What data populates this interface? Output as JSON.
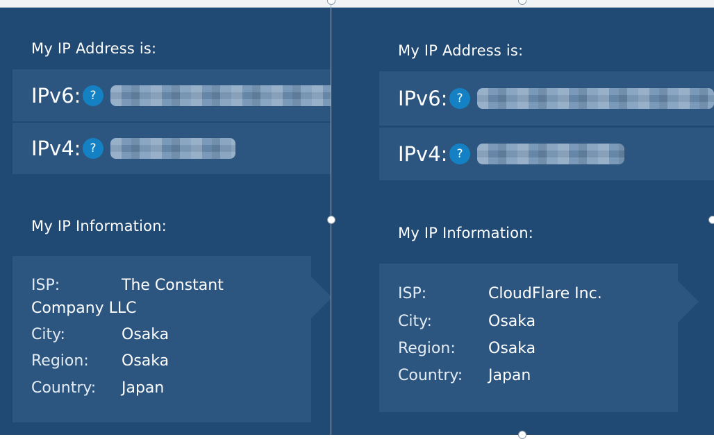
{
  "left": {
    "address_heading": "My IP Address is:",
    "ipv6_label": "IPv6:",
    "ipv4_label": "IPv4:",
    "help_glyph": "?",
    "info_heading": "My IP Information:",
    "info": {
      "isp_key": "ISP:",
      "isp_value_line1": "The Constant",
      "isp_value_line2": "Company LLC",
      "city_key": "City:",
      "city_value": "Osaka",
      "region_key": "Region:",
      "region_value": "Osaka",
      "country_key": "Country:",
      "country_value": "Japan"
    }
  },
  "right": {
    "address_heading": "My IP Address is:",
    "ipv6_label": "IPv6:",
    "ipv4_label": "IPv4:",
    "help_glyph": "?",
    "info_heading": "My IP Information:",
    "info": {
      "isp_key": "ISP:",
      "isp_value": "CloudFlare Inc.",
      "city_key": "City:",
      "city_value": "Osaka",
      "region_key": "Region:",
      "region_value": "Osaka",
      "country_key": "Country:",
      "country_value": "Japan"
    }
  },
  "colors": {
    "panel_bg": "#204a73",
    "row_bg": "#2c5680",
    "help_icon_bg": "#1481c4",
    "redacted_blur": "#6c8eb1"
  },
  "icons": {
    "help": "help-icon"
  }
}
